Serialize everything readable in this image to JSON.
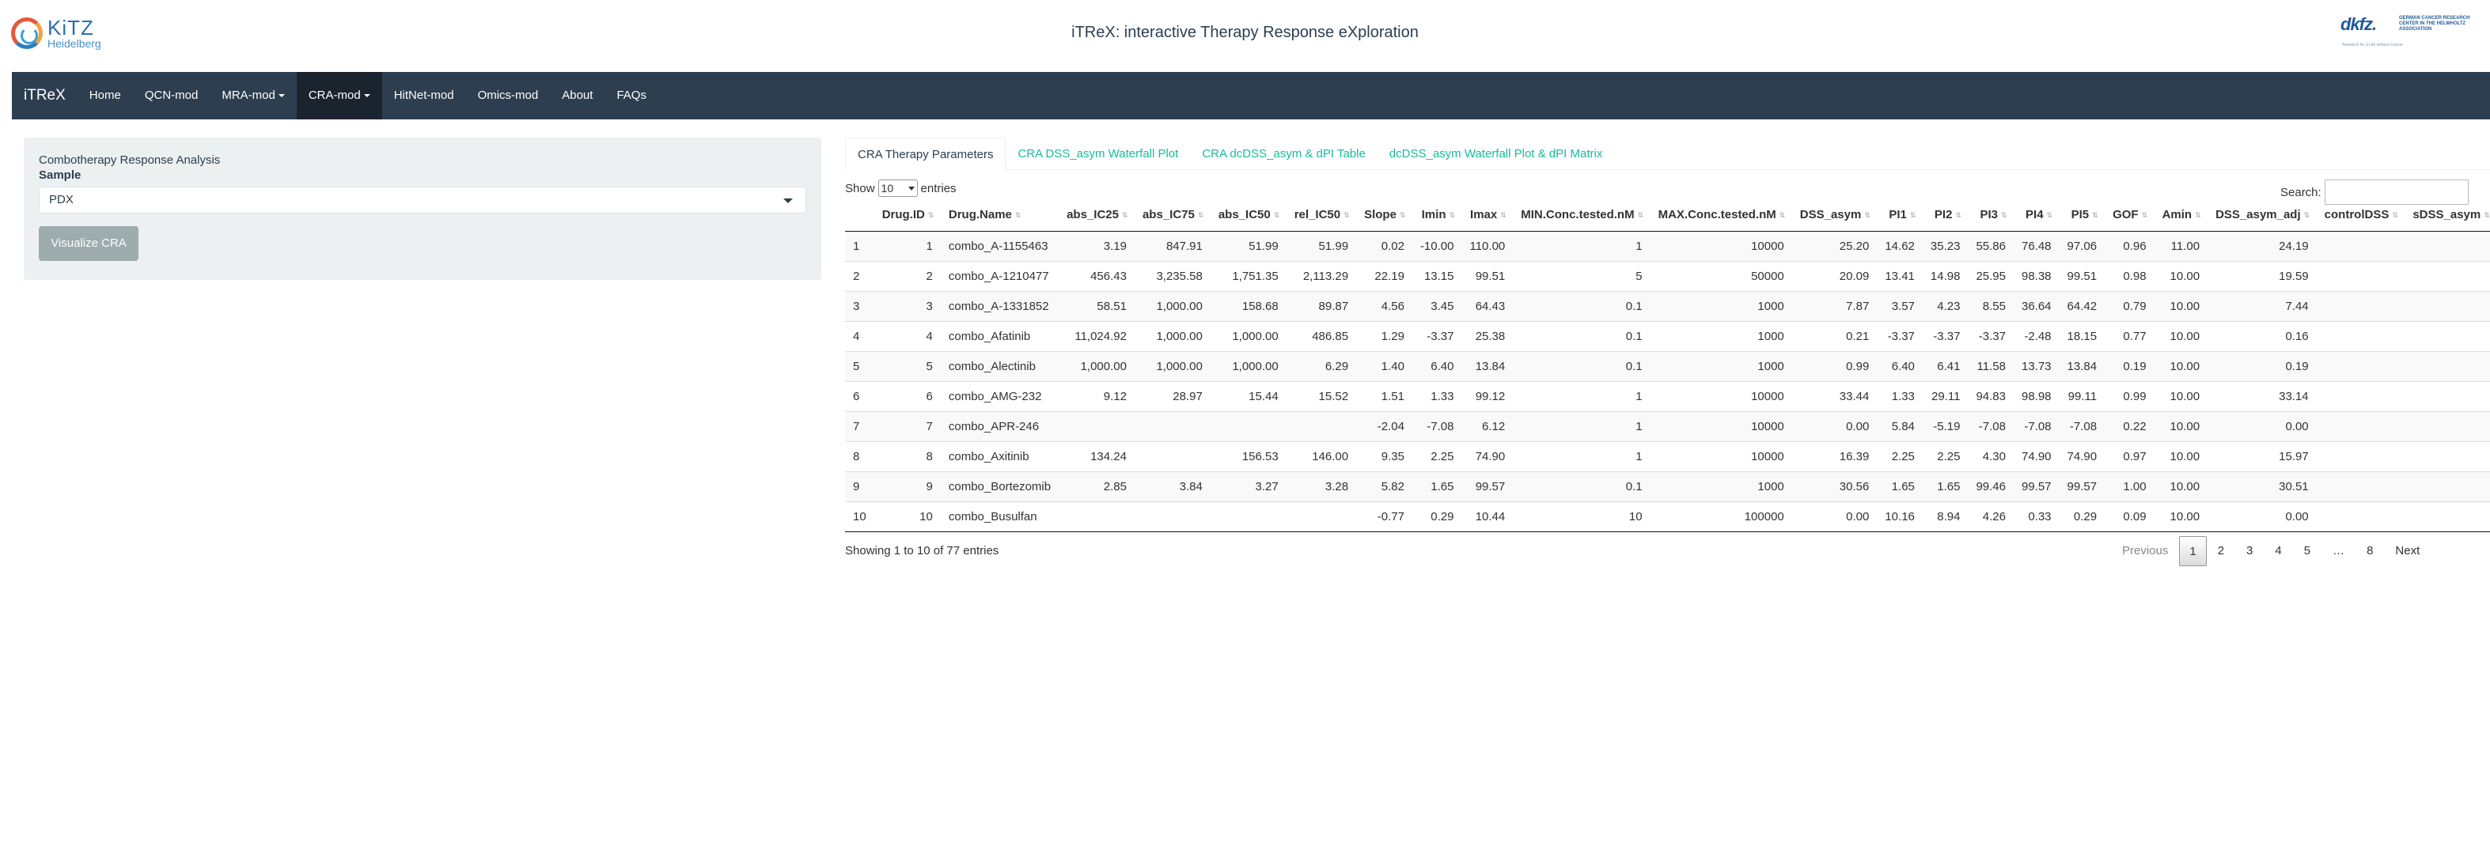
{
  "header": {
    "title": "iTReX: interactive Therapy Response eXploration",
    "logo_left": {
      "line1": "KiTZ",
      "line2": "Heidelberg"
    },
    "logo_right": {
      "mark": "dkfz.",
      "sub": "GERMAN CANCER RESEARCH CENTER IN THE HELMHOLTZ ASSOCIATION",
      "tagline": "Research for a Life without Cancer"
    }
  },
  "navbar": {
    "brand": "iTReX",
    "items": [
      {
        "label": "Home"
      },
      {
        "label": "QCN-mod"
      },
      {
        "label": "MRA-mod"
      },
      {
        "label": "CRA-mod"
      },
      {
        "label": "HitNet-mod"
      },
      {
        "label": "Omics-mod"
      },
      {
        "label": "About"
      },
      {
        "label": "FAQs"
      }
    ]
  },
  "sidebar": {
    "heading": "Combotherapy Response Analysis",
    "sample_label": "Sample",
    "sample_value": "PDX",
    "button": "Visualize CRA"
  },
  "tabs": [
    {
      "label": "CRA Therapy Parameters"
    },
    {
      "label": "CRA DSS_asym Waterfall Plot"
    },
    {
      "label": "CRA dcDSS_asym & dPI Table"
    },
    {
      "label": "dcDSS_asym Waterfall Plot & dPI Matrix"
    }
  ],
  "table_controls": {
    "show": "Show",
    "length_value": "10",
    "entries": "entries",
    "search_label": "Search:"
  },
  "table": {
    "columns": [
      "",
      "Drug.ID",
      "Drug.Name",
      "abs_IC25",
      "abs_IC75",
      "abs_IC50",
      "rel_IC50",
      "Slope",
      "Imin",
      "Imax",
      "MIN.Conc.tested.nM",
      "MAX.Conc.tested.nM",
      "DSS_asym",
      "PI1",
      "PI2",
      "PI3",
      "PI4",
      "PI5",
      "GOF",
      "Amin",
      "DSS_asym_adj",
      "controlDSS",
      "sDSS_asym"
    ],
    "rows": [
      [
        "1",
        "1",
        "combo_A-1155463",
        "3.19",
        "847.91",
        "51.99",
        "51.99",
        "0.02",
        "-10.00",
        "110.00",
        "1",
        "10000",
        "25.20",
        "14.62",
        "35.23",
        "55.86",
        "76.48",
        "97.06",
        "0.96",
        "11.00",
        "24.19",
        "",
        ""
      ],
      [
        "2",
        "2",
        "combo_A-1210477",
        "456.43",
        "3,235.58",
        "1,751.35",
        "2,113.29",
        "22.19",
        "13.15",
        "99.51",
        "5",
        "50000",
        "20.09",
        "13.41",
        "14.98",
        "25.95",
        "98.38",
        "99.51",
        "0.98",
        "10.00",
        "19.59",
        "",
        ""
      ],
      [
        "3",
        "3",
        "combo_A-1331852",
        "58.51",
        "1,000.00",
        "158.68",
        "89.87",
        "4.56",
        "3.45",
        "64.43",
        "0.1",
        "1000",
        "7.87",
        "3.57",
        "4.23",
        "8.55",
        "36.64",
        "64.42",
        "0.79",
        "10.00",
        "7.44",
        "",
        ""
      ],
      [
        "4",
        "4",
        "combo_Afatinib",
        "11,024.92",
        "1,000.00",
        "1,000.00",
        "486.85",
        "1.29",
        "-3.37",
        "25.38",
        "0.1",
        "1000",
        "0.21",
        "-3.37",
        "-3.37",
        "-3.37",
        "-2.48",
        "18.15",
        "0.77",
        "10.00",
        "0.16",
        "",
        ""
      ],
      [
        "5",
        "5",
        "combo_Alectinib",
        "1,000.00",
        "1,000.00",
        "1,000.00",
        "6.29",
        "1.40",
        "6.40",
        "13.84",
        "0.1",
        "1000",
        "0.99",
        "6.40",
        "6.41",
        "11.58",
        "13.73",
        "13.84",
        "0.19",
        "10.00",
        "0.19",
        "",
        ""
      ],
      [
        "6",
        "6",
        "combo_AMG-232",
        "9.12",
        "28.97",
        "15.44",
        "15.52",
        "1.51",
        "1.33",
        "99.12",
        "1",
        "10000",
        "33.44",
        "1.33",
        "29.11",
        "94.83",
        "98.98",
        "99.11",
        "0.99",
        "10.00",
        "33.14",
        "",
        ""
      ],
      [
        "7",
        "7",
        "combo_APR-246",
        "",
        "",
        "",
        "",
        "-2.04",
        "-7.08",
        "6.12",
        "1",
        "10000",
        "0.00",
        "5.84",
        "-5.19",
        "-7.08",
        "-7.08",
        "-7.08",
        "0.22",
        "10.00",
        "0.00",
        "",
        ""
      ],
      [
        "8",
        "8",
        "combo_Axitinib",
        "134.24",
        "",
        "156.53",
        "146.00",
        "9.35",
        "2.25",
        "74.90",
        "1",
        "10000",
        "16.39",
        "2.25",
        "2.25",
        "4.30",
        "74.90",
        "74.90",
        "0.97",
        "10.00",
        "15.97",
        "",
        ""
      ],
      [
        "9",
        "9",
        "combo_Bortezomib",
        "2.85",
        "3.84",
        "3.27",
        "3.28",
        "5.82",
        "1.65",
        "99.57",
        "0.1",
        "1000",
        "30.56",
        "1.65",
        "1.65",
        "99.46",
        "99.57",
        "99.57",
        "1.00",
        "10.00",
        "30.51",
        "",
        ""
      ],
      [
        "10",
        "10",
        "combo_Busulfan",
        "",
        "",
        "",
        "",
        "-0.77",
        "0.29",
        "10.44",
        "10",
        "100000",
        "0.00",
        "10.16",
        "8.94",
        "4.26",
        "0.33",
        "0.29",
        "0.09",
        "10.00",
        "0.00",
        "",
        ""
      ]
    ]
  },
  "footer": {
    "info": "Showing 1 to 10 of 77 entries",
    "pager": [
      "Previous",
      "1",
      "2",
      "3",
      "4",
      "5",
      "…",
      "8",
      "Next"
    ]
  }
}
